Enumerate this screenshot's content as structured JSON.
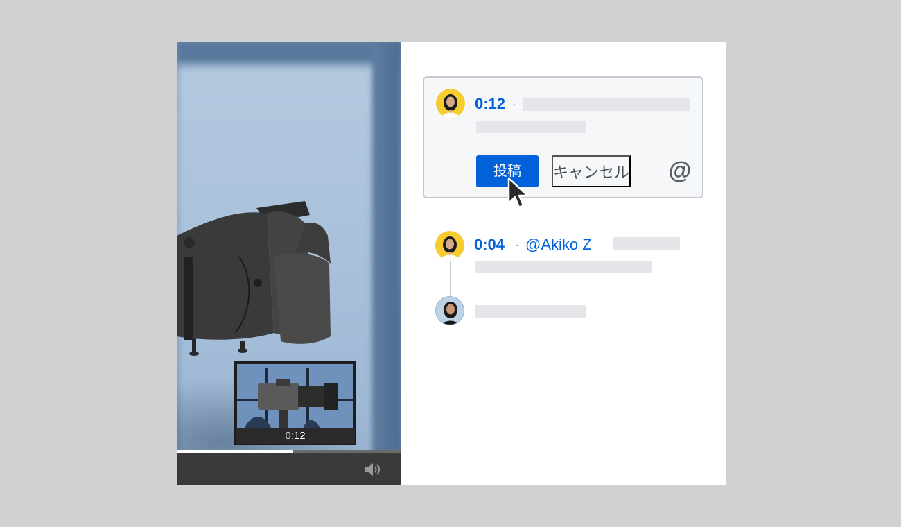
{
  "video": {
    "thumbnail_time": "0:12",
    "progress": 0.52
  },
  "composer": {
    "timestamp": "0:12",
    "separator": "·",
    "post_label": "投稿",
    "cancel_label": "キャンセル",
    "mention_icon": "@"
  },
  "thread": {
    "first": {
      "timestamp": "0:04",
      "separator": "·",
      "mention": "@Akiko Z"
    }
  },
  "colors": {
    "accent": "#0061d9",
    "background": "#d1d1d3",
    "placeholder": "#e4e6ea"
  }
}
